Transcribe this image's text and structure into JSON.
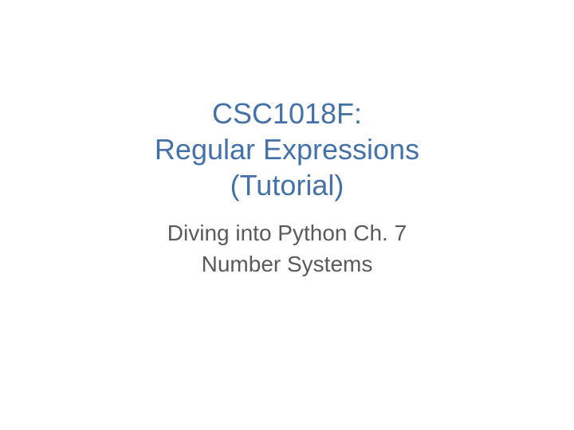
{
  "slide": {
    "title_line1": "CSC1018F:",
    "title_line2": "Regular Expressions",
    "title_line3": "(Tutorial)",
    "subtitle_line1": "Diving into Python Ch. 7",
    "subtitle_line2": "Number Systems"
  }
}
